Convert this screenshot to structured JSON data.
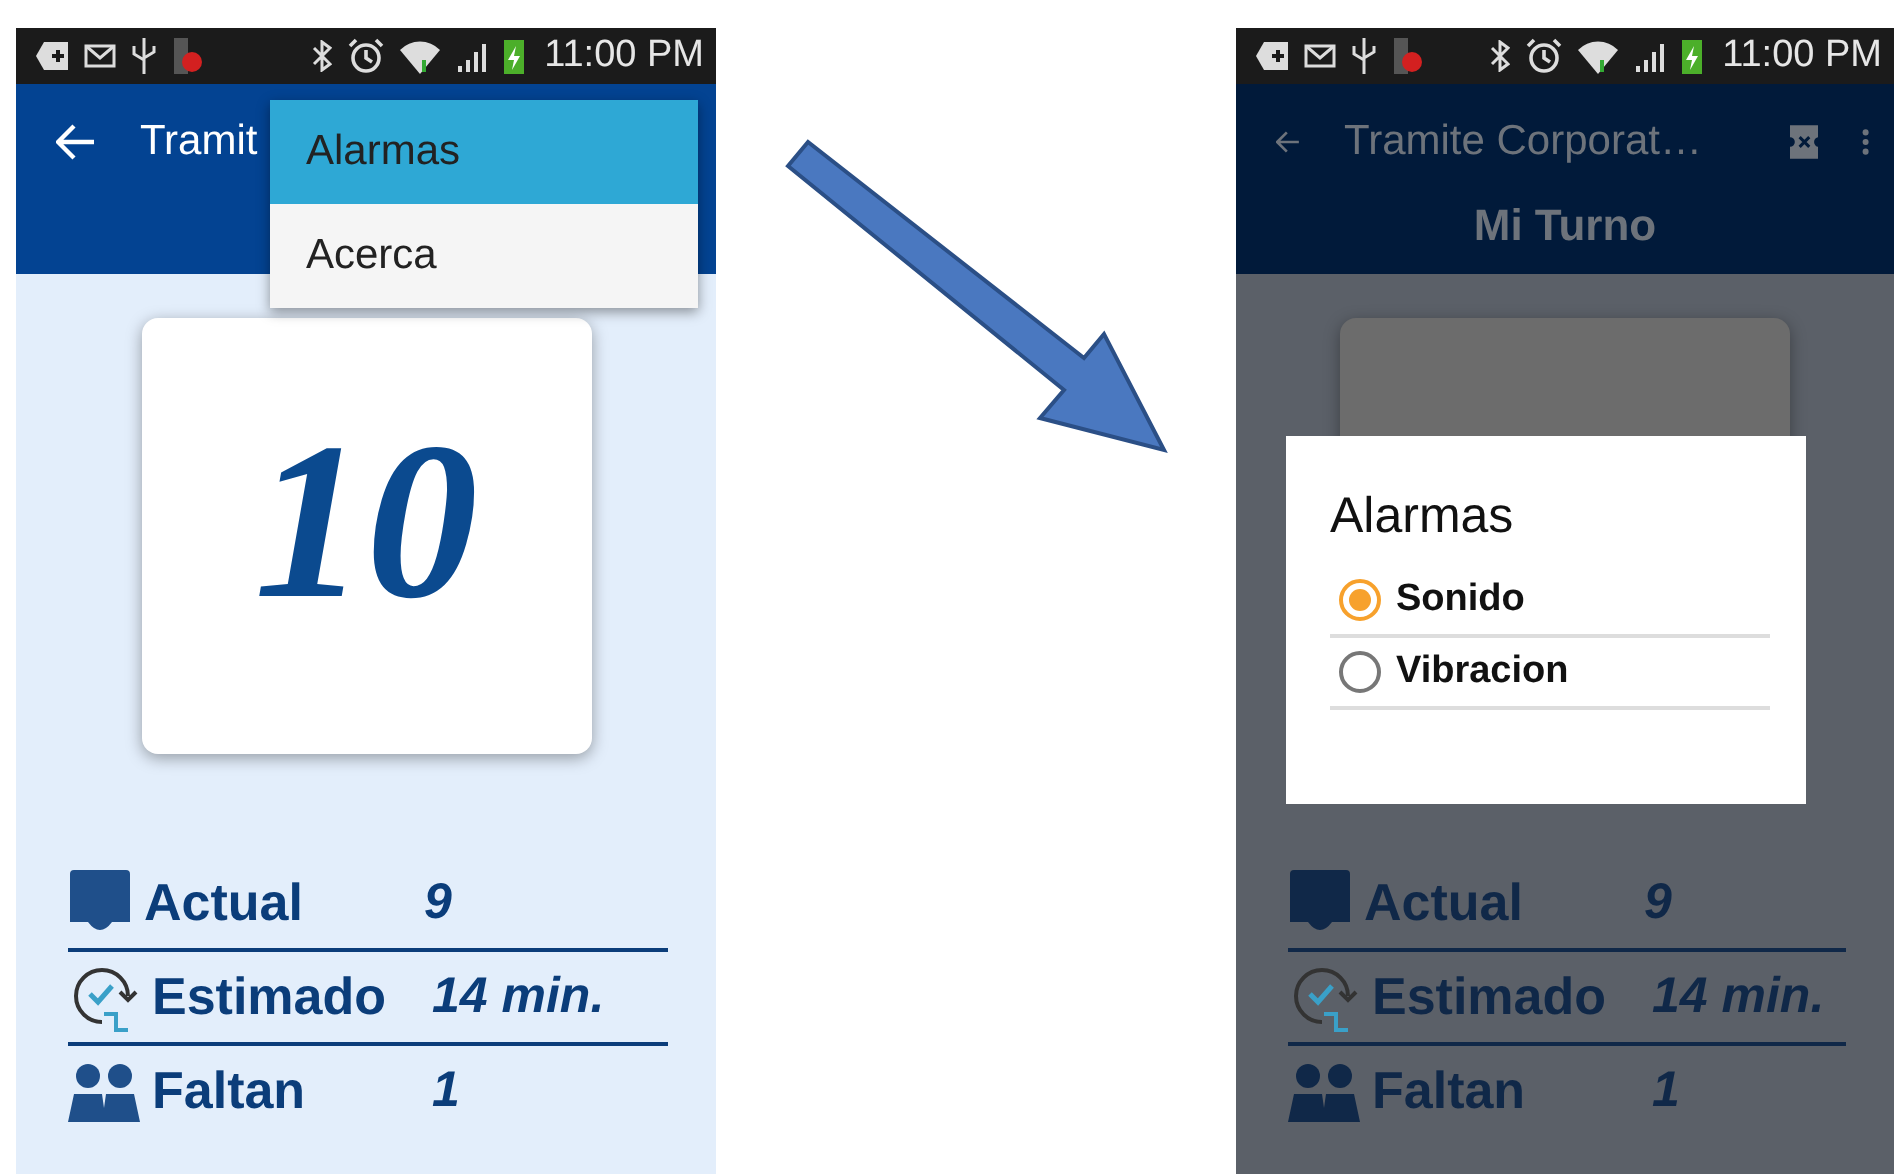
{
  "screens": [
    {
      "kind": "menu",
      "status_time": "11:00 PM",
      "title": "Tramit",
      "ticket_number": "10",
      "menu": {
        "items": [
          {
            "label": "Alarmas",
            "selected": true
          },
          {
            "label": "Acerca",
            "selected": false
          }
        ]
      },
      "stats": [
        {
          "kind": "ticket",
          "label": "Actual",
          "value": "9"
        },
        {
          "kind": "clock",
          "label": "Estimado",
          "value": "14 min."
        },
        {
          "kind": "people",
          "label": "Faltan",
          "value": "1"
        }
      ]
    },
    {
      "kind": "dialog",
      "status_time": "11:00 PM",
      "title": "Tramite Corporat…",
      "subtitle": "Mi Turno",
      "dialog": {
        "title": "Alarmas",
        "options": [
          {
            "label": "Sonido",
            "selected": true
          },
          {
            "label": "Vibracion",
            "selected": false
          }
        ]
      },
      "stats": [
        {
          "kind": "ticket",
          "label": "Actual",
          "value": "9"
        },
        {
          "kind": "clock",
          "label": "Estimado",
          "value": "14 min."
        },
        {
          "kind": "people",
          "label": "Faltan",
          "value": "1"
        }
      ]
    }
  ]
}
